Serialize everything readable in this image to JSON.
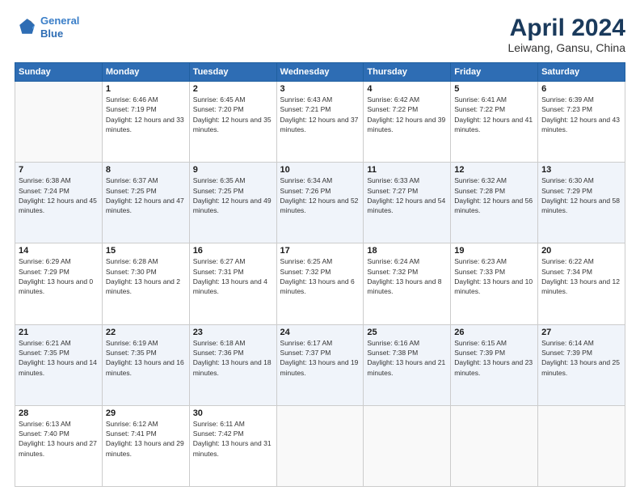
{
  "header": {
    "logo_line1": "General",
    "logo_line2": "Blue",
    "title": "April 2024",
    "subtitle": "Leiwang, Gansu, China"
  },
  "weekdays": [
    "Sunday",
    "Monday",
    "Tuesday",
    "Wednesday",
    "Thursday",
    "Friday",
    "Saturday"
  ],
  "weeks": [
    [
      {
        "day": "",
        "empty": true
      },
      {
        "day": "1",
        "sunrise": "6:46 AM",
        "sunset": "7:19 PM",
        "daylight": "12 hours and 33 minutes."
      },
      {
        "day": "2",
        "sunrise": "6:45 AM",
        "sunset": "7:20 PM",
        "daylight": "12 hours and 35 minutes."
      },
      {
        "day": "3",
        "sunrise": "6:43 AM",
        "sunset": "7:21 PM",
        "daylight": "12 hours and 37 minutes."
      },
      {
        "day": "4",
        "sunrise": "6:42 AM",
        "sunset": "7:22 PM",
        "daylight": "12 hours and 39 minutes."
      },
      {
        "day": "5",
        "sunrise": "6:41 AM",
        "sunset": "7:22 PM",
        "daylight": "12 hours and 41 minutes."
      },
      {
        "day": "6",
        "sunrise": "6:39 AM",
        "sunset": "7:23 PM",
        "daylight": "12 hours and 43 minutes."
      }
    ],
    [
      {
        "day": "7",
        "sunrise": "6:38 AM",
        "sunset": "7:24 PM",
        "daylight": "12 hours and 45 minutes."
      },
      {
        "day": "8",
        "sunrise": "6:37 AM",
        "sunset": "7:25 PM",
        "daylight": "12 hours and 47 minutes."
      },
      {
        "day": "9",
        "sunrise": "6:35 AM",
        "sunset": "7:25 PM",
        "daylight": "12 hours and 49 minutes."
      },
      {
        "day": "10",
        "sunrise": "6:34 AM",
        "sunset": "7:26 PM",
        "daylight": "12 hours and 52 minutes."
      },
      {
        "day": "11",
        "sunrise": "6:33 AM",
        "sunset": "7:27 PM",
        "daylight": "12 hours and 54 minutes."
      },
      {
        "day": "12",
        "sunrise": "6:32 AM",
        "sunset": "7:28 PM",
        "daylight": "12 hours and 56 minutes."
      },
      {
        "day": "13",
        "sunrise": "6:30 AM",
        "sunset": "7:29 PM",
        "daylight": "12 hours and 58 minutes."
      }
    ],
    [
      {
        "day": "14",
        "sunrise": "6:29 AM",
        "sunset": "7:29 PM",
        "daylight": "13 hours and 0 minutes."
      },
      {
        "day": "15",
        "sunrise": "6:28 AM",
        "sunset": "7:30 PM",
        "daylight": "13 hours and 2 minutes."
      },
      {
        "day": "16",
        "sunrise": "6:27 AM",
        "sunset": "7:31 PM",
        "daylight": "13 hours and 4 minutes."
      },
      {
        "day": "17",
        "sunrise": "6:25 AM",
        "sunset": "7:32 PM",
        "daylight": "13 hours and 6 minutes."
      },
      {
        "day": "18",
        "sunrise": "6:24 AM",
        "sunset": "7:32 PM",
        "daylight": "13 hours and 8 minutes."
      },
      {
        "day": "19",
        "sunrise": "6:23 AM",
        "sunset": "7:33 PM",
        "daylight": "13 hours and 10 minutes."
      },
      {
        "day": "20",
        "sunrise": "6:22 AM",
        "sunset": "7:34 PM",
        "daylight": "13 hours and 12 minutes."
      }
    ],
    [
      {
        "day": "21",
        "sunrise": "6:21 AM",
        "sunset": "7:35 PM",
        "daylight": "13 hours and 14 minutes."
      },
      {
        "day": "22",
        "sunrise": "6:19 AM",
        "sunset": "7:35 PM",
        "daylight": "13 hours and 16 minutes."
      },
      {
        "day": "23",
        "sunrise": "6:18 AM",
        "sunset": "7:36 PM",
        "daylight": "13 hours and 18 minutes."
      },
      {
        "day": "24",
        "sunrise": "6:17 AM",
        "sunset": "7:37 PM",
        "daylight": "13 hours and 19 minutes."
      },
      {
        "day": "25",
        "sunrise": "6:16 AM",
        "sunset": "7:38 PM",
        "daylight": "13 hours and 21 minutes."
      },
      {
        "day": "26",
        "sunrise": "6:15 AM",
        "sunset": "7:39 PM",
        "daylight": "13 hours and 23 minutes."
      },
      {
        "day": "27",
        "sunrise": "6:14 AM",
        "sunset": "7:39 PM",
        "daylight": "13 hours and 25 minutes."
      }
    ],
    [
      {
        "day": "28",
        "sunrise": "6:13 AM",
        "sunset": "7:40 PM",
        "daylight": "13 hours and 27 minutes."
      },
      {
        "day": "29",
        "sunrise": "6:12 AM",
        "sunset": "7:41 PM",
        "daylight": "13 hours and 29 minutes."
      },
      {
        "day": "30",
        "sunrise": "6:11 AM",
        "sunset": "7:42 PM",
        "daylight": "13 hours and 31 minutes."
      },
      {
        "day": "",
        "empty": true
      },
      {
        "day": "",
        "empty": true
      },
      {
        "day": "",
        "empty": true
      },
      {
        "day": "",
        "empty": true
      }
    ]
  ]
}
